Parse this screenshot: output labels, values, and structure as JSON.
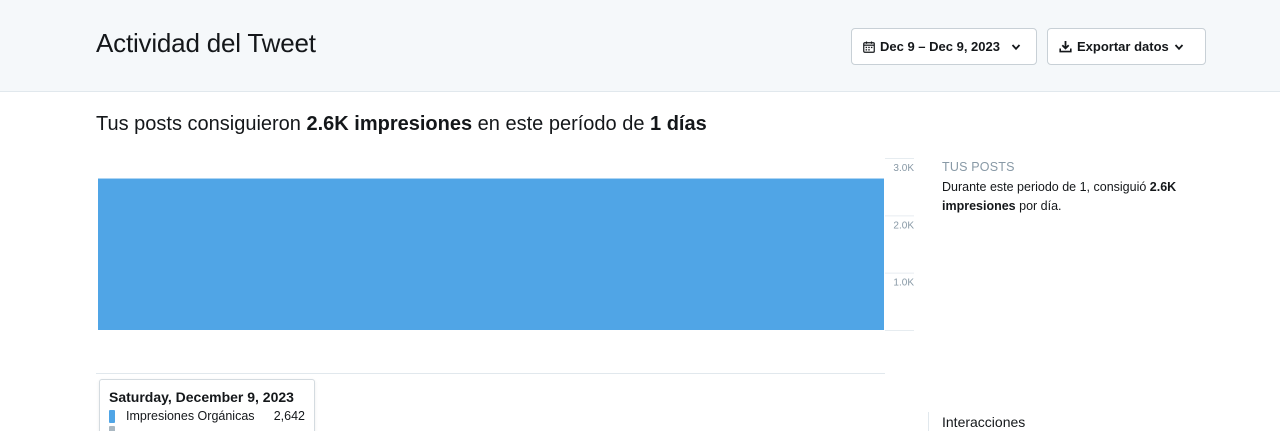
{
  "header": {
    "title": "Actividad del Tweet",
    "date_range_label": "Dec 9 – Dec 9, 2023",
    "export_label": "Exportar datos"
  },
  "summary": {
    "prefix": "Tus posts consiguieron ",
    "impressions": "2.6K impresiones",
    "middle": " en este período de ",
    "period": "1 días"
  },
  "side": {
    "label": "TUS POSTS",
    "desc_prefix": "Durante este periodo de 1, consiguió ",
    "desc_value": "2.6K impresiones",
    "desc_suffix": " por día.",
    "interactions_label": "Interacciones"
  },
  "tooltip": {
    "date": "Saturday, December 9, 2023",
    "rows": [
      {
        "label": "Impresiones Orgánicas",
        "value": "2,642",
        "color": "#50a5e6"
      },
      {
        "label": "",
        "value": "",
        "color": "#aab8c2"
      }
    ]
  },
  "colors": {
    "bar": "#50a5e6",
    "header_bg": "#f5f8fa",
    "muted": "#8899a6"
  },
  "icons": {
    "date": "calendar-icon",
    "export": "download-icon",
    "chevron": "chevron-down-icon"
  },
  "chart_data": {
    "type": "bar",
    "categories": [
      "Dec 9, 2023"
    ],
    "series": [
      {
        "name": "Impresiones Orgánicas",
        "values": [
          2642
        ]
      }
    ],
    "yticks": [
      "3.0K",
      "2.0K",
      "1.0K"
    ],
    "ytick_values": [
      3000,
      2000,
      1000
    ],
    "ylim": [
      0,
      3000
    ],
    "grid": false,
    "y_axis_position": "right"
  }
}
